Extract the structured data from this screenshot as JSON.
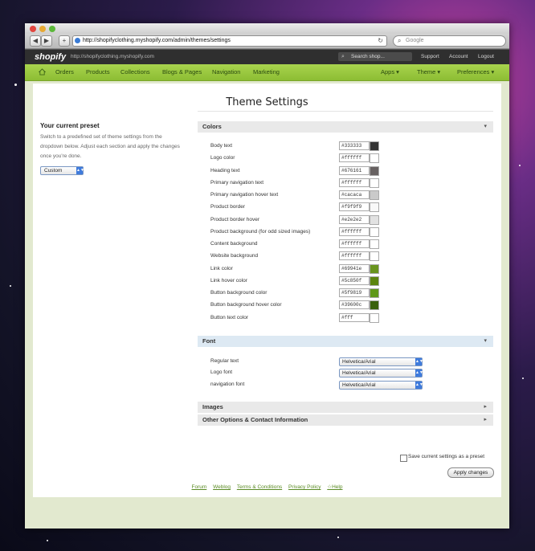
{
  "browser": {
    "url": "http://shopifyclothing.myshopify.com/admin/themes/settings",
    "search_placeholder": "Google",
    "back": "◀",
    "forward": "▶",
    "add": "+",
    "reload": "↻",
    "search_icon": "⌕"
  },
  "admin_bar": {
    "logo": "shopify",
    "store_url": "http://shopifyclothing.myshopify.com",
    "search_placeholder": "Search shop...",
    "links": [
      "Support",
      "Account",
      "Logout"
    ]
  },
  "nav": {
    "left": [
      "Orders",
      "Products",
      "Collections",
      "Blogs & Pages",
      "Navigation",
      "Marketing"
    ],
    "right": [
      "Apps ▾",
      "Theme ▾",
      "Preferences ▾"
    ]
  },
  "page": {
    "title": "Theme Settings",
    "preset": {
      "heading": "Your current preset",
      "description": "Switch to a predefined set of theme settings from the dropdown below. Adjust each section and apply the changes once you're done.",
      "value": "Custom"
    }
  },
  "sections": {
    "colors": {
      "title": "Colors",
      "arrow": "▾",
      "rows": [
        {
          "label": "Body text",
          "value": "#333333",
          "swatch": "#333333"
        },
        {
          "label": "Logo color",
          "value": "#ffffff",
          "swatch": "#ffffff"
        },
        {
          "label": "Heading text",
          "value": "#676161",
          "swatch": "#676161"
        },
        {
          "label": "Primary navigation text",
          "value": "#ffffff",
          "swatch": "#ffffff"
        },
        {
          "label": "Primary navigation hover text",
          "value": "#cacaca",
          "swatch": "#cacaca"
        },
        {
          "label": "Product border",
          "value": "#f9f9f9",
          "swatch": "#f9f9f9"
        },
        {
          "label": "Product border hover",
          "value": "#e2e2e2",
          "swatch": "#e2e2e2"
        },
        {
          "label": "Product background (for odd sized images)",
          "value": "#ffffff",
          "swatch": "#ffffff"
        },
        {
          "label": "Content background",
          "value": "#ffffff",
          "swatch": "#ffffff"
        },
        {
          "label": "Website background",
          "value": "#ffffff",
          "swatch": "#ffffff"
        },
        {
          "label": "Link color",
          "value": "#69941e",
          "swatch": "#69941e"
        },
        {
          "label": "Link hover color",
          "value": "#5c850f",
          "swatch": "#5c850f"
        },
        {
          "label": "Button background color",
          "value": "#5f9819",
          "swatch": "#5f9819"
        },
        {
          "label": "Button background hover color",
          "value": "#39600c",
          "swatch": "#39600c"
        },
        {
          "label": "Button text color",
          "value": "#fff",
          "swatch": "#ffffff"
        }
      ]
    },
    "font": {
      "title": "Font",
      "arrow": "▾",
      "rows": [
        {
          "label": "Regular text",
          "value": "Helvetica/Arial"
        },
        {
          "label": "Logo font",
          "value": "Helvetica/Arial"
        },
        {
          "label": "navigation font",
          "value": "Helvetica/Arial"
        }
      ]
    },
    "images": {
      "title": "Images",
      "arrow": "▸"
    },
    "other": {
      "title": "Other Options & Contact Information",
      "arrow": "▸"
    }
  },
  "actions": {
    "save_preset_label": "Save current settings as a preset",
    "apply_label": "Apply changes"
  },
  "footer": {
    "links": [
      "Forum",
      "Weblog",
      "Terms & Conditions",
      "Privacy Policy",
      "☆Help"
    ]
  }
}
